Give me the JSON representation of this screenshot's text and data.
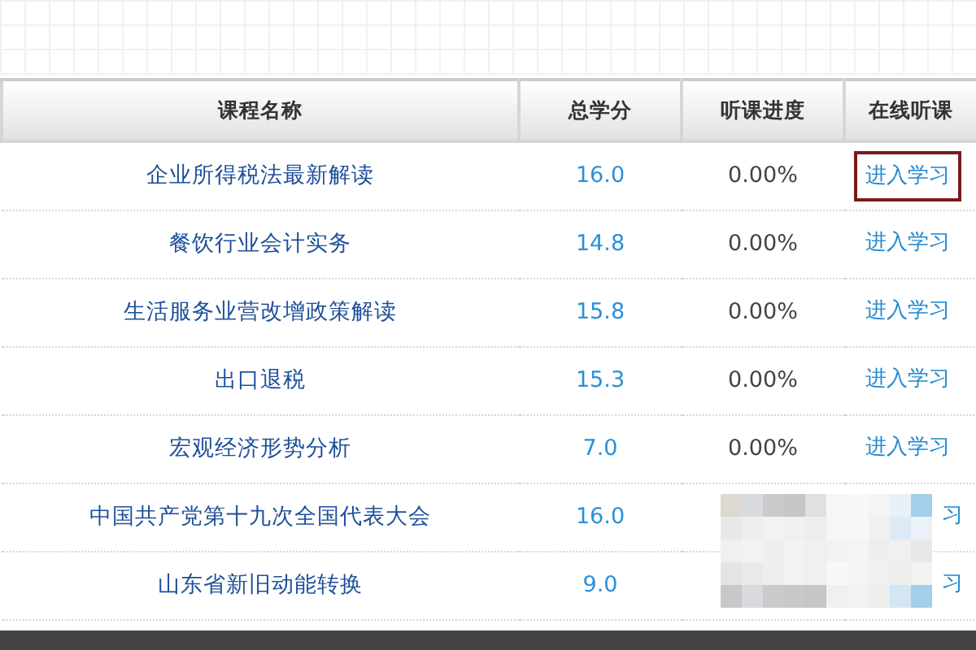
{
  "table": {
    "columns": [
      "课程名称",
      "总学分",
      "听课进度",
      "在线听课"
    ],
    "rows": [
      {
        "name": "企业所得税法最新解读",
        "credits": "16.0",
        "progress": "0.00%",
        "link": "进入学习",
        "focused": true,
        "obscured": false
      },
      {
        "name": "餐饮行业会计实务",
        "credits": "14.8",
        "progress": "0.00%",
        "link": "进入学习",
        "focused": false,
        "obscured": false
      },
      {
        "name": "生活服务业营改增政策解读",
        "credits": "15.8",
        "progress": "0.00%",
        "link": "进入学习",
        "focused": false,
        "obscured": false
      },
      {
        "name": "出口退税",
        "credits": "15.3",
        "progress": "0.00%",
        "link": "进入学习",
        "focused": false,
        "obscured": false
      },
      {
        "name": "宏观经济形势分析",
        "credits": "7.0",
        "progress": "0.00%",
        "link": "进入学习",
        "focused": false,
        "obscured": false
      },
      {
        "name": "中国共产党第十九次全国代表大会",
        "credits": "16.0",
        "link": "习",
        "focused": false,
        "obscured": true
      },
      {
        "name": "山东省新旧动能转换",
        "credits": "9.0",
        "link": "习",
        "focused": false,
        "obscured": true
      }
    ]
  }
}
